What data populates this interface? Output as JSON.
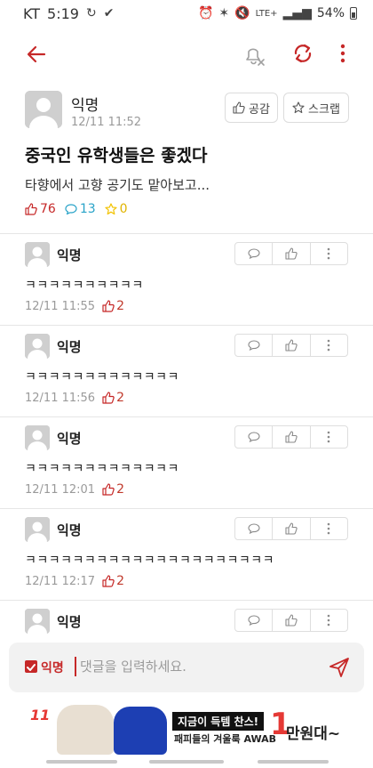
{
  "status_bar": {
    "carrier": "KT",
    "time": "5:19",
    "network": "LTE+",
    "battery": "54%"
  },
  "app_bar": {
    "icons": [
      "back-arrow-icon",
      "bell-off-icon",
      "refresh-icon",
      "more-vert-icon"
    ]
  },
  "post": {
    "author": "익명",
    "timestamp": "12/11 11:52",
    "like_label": "공감",
    "scrap_label": "스크랩",
    "title": "중국인 유학생들은 좋겠다",
    "body": "타향에서 고향 공기도 맡아보고...",
    "likes": "76",
    "comments": "13",
    "scraps": "0"
  },
  "comments": [
    {
      "author": "익명",
      "text": "ㅋㅋㅋㅋㅋㅋㅋㅋㅋㅋ",
      "time": "12/11 11:55",
      "likes": "2"
    },
    {
      "author": "익명",
      "text": "ㅋㅋㅋㅋㅋㅋㅋㅋㅋㅋㅋㅋㅋ",
      "time": "12/11 11:56",
      "likes": "2"
    },
    {
      "author": "익명",
      "text": "ㅋㅋㅋㅋㅋㅋㅋㅋㅋㅋㅋㅋㅋ",
      "time": "12/11 12:01",
      "likes": "2"
    },
    {
      "author": "익명",
      "text": "ㅋㅋㅋㅋㅋㅋㅋㅋㅋㅋㅋㅋㅋㅋㅋㅋㅋㅋㅋㅋㅋ",
      "time": "12/11 12:17",
      "likes": "2"
    },
    {
      "author": "익명"
    }
  ],
  "comment_input": {
    "anonymous_label": "익명",
    "placeholder": "댓글을 입력하세요."
  },
  "ad": {
    "brand": "11",
    "headline": "지금이 득템 찬스!",
    "subline": "패피들의 겨울룩 AWAB",
    "amount": "1",
    "unit": "만원대~"
  },
  "colors": {
    "accent": "#c62828",
    "comment_icon": "#29a3c8",
    "scrap_icon": "#f2c200",
    "muted": "#9a9a9a"
  }
}
